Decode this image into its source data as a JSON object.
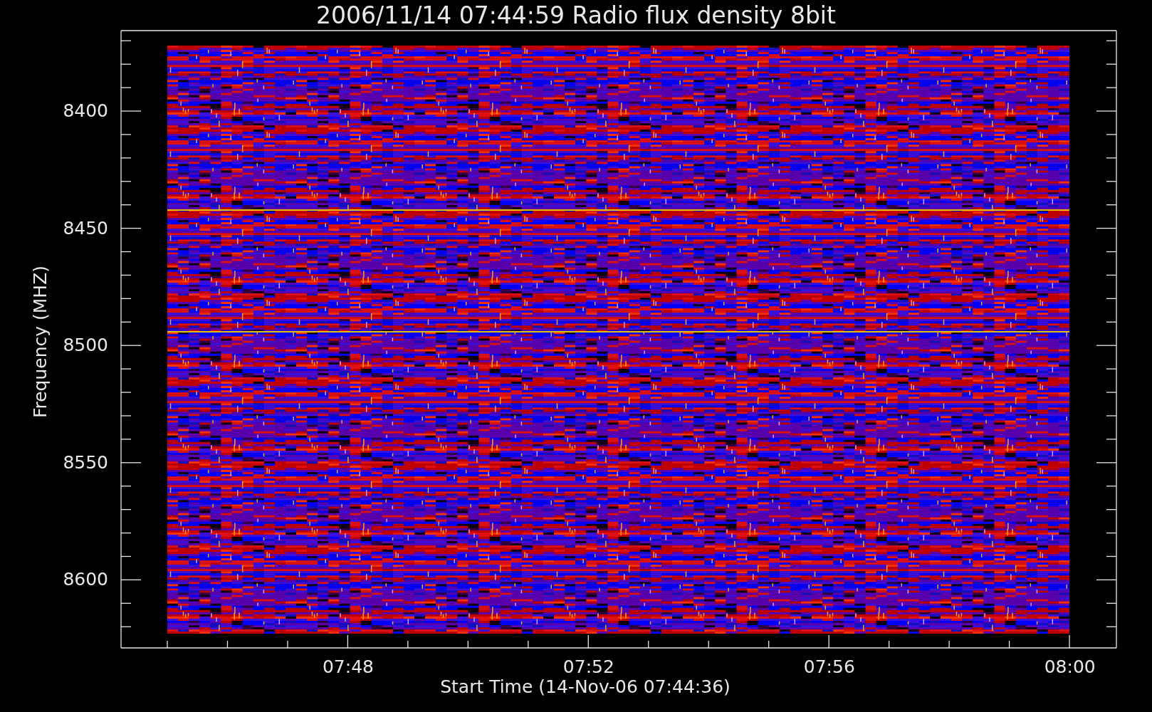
{
  "title": "2006/11/14 07:44:59 Radio flux density 8bit",
  "plot": {
    "y_label": "Frequency (MHZ)",
    "y_tick_labels": [
      "8400",
      "8450",
      "8500",
      "8550",
      "8600"
    ],
    "x_tick_labels": [
      "07:48",
      "07:52",
      "07:56",
      "08:00"
    ],
    "x_label": "Start Time (14-Nov-06 07:44:36)"
  }
}
